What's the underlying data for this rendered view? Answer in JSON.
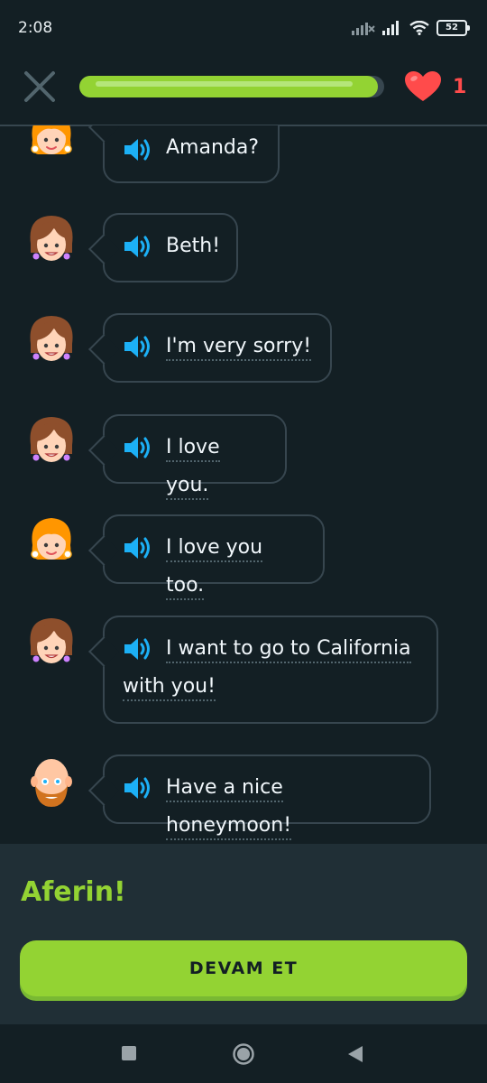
{
  "status": {
    "time": "2:08",
    "battery": "52"
  },
  "header": {
    "progress": 0.98,
    "hearts": "1"
  },
  "messages": [
    {
      "speaker": "girl",
      "text": "Amanda?",
      "lines": [
        "Amanda?"
      ]
    },
    {
      "speaker": "woman",
      "text": "Beth!",
      "lines": [
        "Beth!"
      ]
    },
    {
      "speaker": "woman",
      "text": "I'm very sorry!",
      "lines": [
        "I'm very sorry!"
      ]
    },
    {
      "speaker": "woman",
      "text": "I love you.",
      "lines": [
        "I love you."
      ]
    },
    {
      "speaker": "girl",
      "text": "I love you too.",
      "lines": [
        "I love you too."
      ]
    },
    {
      "speaker": "woman",
      "text": "I want to go to California with you!",
      "lines": [
        "I want to go to California",
        "with you!"
      ]
    },
    {
      "speaker": "bald-man",
      "text": "Have a nice honeymoon!",
      "lines": [
        "Have a nice honeymoon!"
      ]
    }
  ],
  "feedback": {
    "title": "Aferin!",
    "button": "DEVAM ET"
  },
  "colors": {
    "accent": "#93d333",
    "heart": "#ff4b4b",
    "speaker": "#1cb0f6",
    "background": "#131f24"
  }
}
